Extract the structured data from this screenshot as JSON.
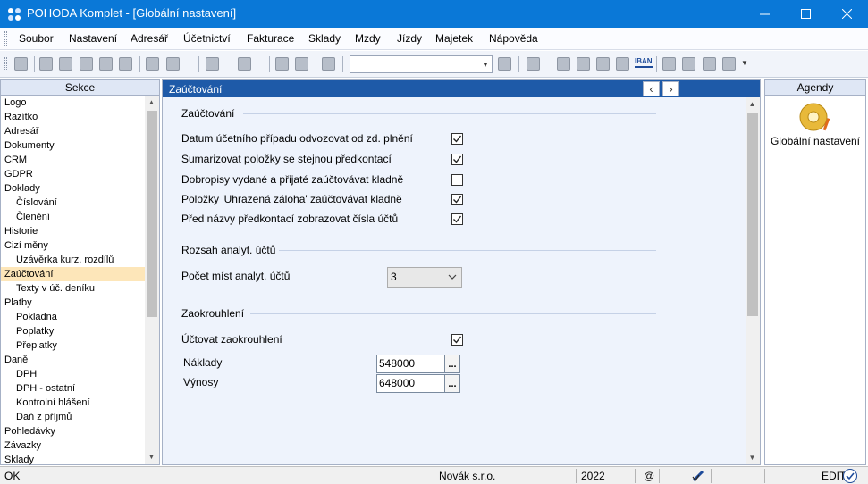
{
  "window": {
    "title": "POHODA Komplet - [Globální nastavení]"
  },
  "menu": [
    "Soubor",
    "Nastavení",
    "Adresář",
    "Účetnictví",
    "Fakturace",
    "Sklady",
    "Mzdy",
    "Jízdy",
    "Majetek",
    "Nápověda"
  ],
  "toolbar": {
    "iban_label": "IBAN",
    "combo_value": ""
  },
  "left_panel": {
    "title": "Sekce",
    "items": [
      {
        "label": "Logo",
        "indent": 0
      },
      {
        "label": "Razítko",
        "indent": 0
      },
      {
        "label": "Adresář",
        "indent": 0
      },
      {
        "label": "Dokumenty",
        "indent": 0
      },
      {
        "label": "CRM",
        "indent": 0
      },
      {
        "label": "GDPR",
        "indent": 0
      },
      {
        "label": "Doklady",
        "indent": 0
      },
      {
        "label": "Číslování",
        "indent": 1
      },
      {
        "label": "Členění",
        "indent": 1
      },
      {
        "label": "Historie",
        "indent": 0
      },
      {
        "label": "Cizí měny",
        "indent": 0
      },
      {
        "label": "Uzávěrka kurz. rozdílů",
        "indent": 1
      },
      {
        "label": "Zaúčtování",
        "indent": 0,
        "selected": true
      },
      {
        "label": "Texty v úč. deníku",
        "indent": 1
      },
      {
        "label": "Platby",
        "indent": 0
      },
      {
        "label": "Pokladna",
        "indent": 1
      },
      {
        "label": "Poplatky",
        "indent": 1
      },
      {
        "label": "Přeplatky",
        "indent": 1
      },
      {
        "label": "Daně",
        "indent": 0
      },
      {
        "label": "DPH",
        "indent": 1
      },
      {
        "label": "DPH - ostatní",
        "indent": 1
      },
      {
        "label": "Kontrolní hlášení",
        "indent": 1
      },
      {
        "label": "Daň z příjmů",
        "indent": 1
      },
      {
        "label": "Pohledávky",
        "indent": 0
      },
      {
        "label": "Závazky",
        "indent": 0
      },
      {
        "label": "Sklady",
        "indent": 0
      }
    ]
  },
  "content": {
    "title": "Zaúčtování",
    "section1": {
      "title": "Zaúčtování",
      "options": [
        {
          "label": "Datum účetního případu odvozovat od zd. plnění",
          "checked": true
        },
        {
          "label": "Sumarizovat položky se stejnou předkontací",
          "checked": true
        },
        {
          "label": "Dobropisy vydané a přijaté zaúčtovávat kladně",
          "checked": false
        },
        {
          "label": "Položky 'Uhrazená záloha' zaúčtovávat kladně",
          "checked": true
        },
        {
          "label": "Před názvy předkontací zobrazovat čísla účtů",
          "checked": true
        }
      ]
    },
    "section2": {
      "title": "Rozsah analyt. účtů",
      "field_label": "Počet míst analyt. účtů",
      "value": "3"
    },
    "section3": {
      "title": "Zaokrouhlení",
      "option": {
        "label": "Účtovat zaokrouhlení",
        "checked": true
      },
      "naklady_label": "Náklady",
      "naklady_value": "548000",
      "vynosy_label": "Výnosy",
      "vynosy_value": "648000",
      "browse_label": "..."
    }
  },
  "right_panel": {
    "title": "Agendy",
    "item": "Globální nastavení"
  },
  "status": {
    "left": "OK",
    "company": "Novák s.r.o.",
    "year": "2022",
    "at": "@",
    "edit": "EDIT"
  },
  "colors": {
    "titlebar": "#0a78d7",
    "content_header": "#1e5aa8",
    "selection": "#fde6b9",
    "form_bg": "#eef3fc"
  }
}
